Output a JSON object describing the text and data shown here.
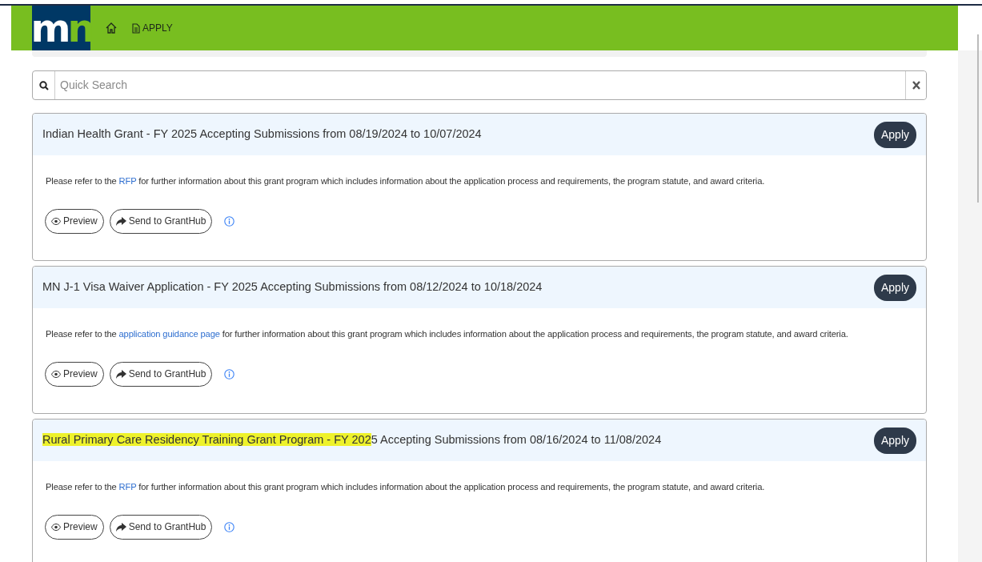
{
  "navbar": {
    "logo": "mn",
    "links": [
      {
        "kind": "home"
      },
      {
        "kind": "document",
        "label": "APPLY"
      }
    ]
  },
  "search": {
    "placeholder": "Quick Search"
  },
  "grants": [
    {
      "title": [
        {
          "text": "Indian Health Grant - FY 2025 Accepting Submissions from 08/19/2024 to 10/07/2024",
          "highlighted": false
        }
      ],
      "apply": "Apply",
      "description": {
        "before": "Please refer to the ",
        "link": "RFP",
        "after": " for further information about this grant program which includes information about the application process and requirements, the program statute, and award criteria."
      },
      "buttons": [
        {
          "kind": "preview",
          "label": "Preview"
        },
        {
          "kind": "send",
          "label": "Send to GrantHub"
        }
      ]
    },
    {
      "title": [
        {
          "text": "MN J-1 Visa Waiver Application - FY 2025 Accepting Submissions from 08/12/2024 to 10/18/2024",
          "highlighted": false
        }
      ],
      "apply": "Apply",
      "description": {
        "before": "Please refer to the ",
        "link": "application guidance page",
        "after": " for further information about this grant program which includes information about the application process and requirements, the program statute, and award criteria."
      },
      "buttons": [
        {
          "kind": "preview",
          "label": "Preview"
        },
        {
          "kind": "send",
          "label": "Send to GrantHub"
        }
      ]
    },
    {
      "title": [
        {
          "text": "Rural Primary Care Residency Training Grant Program - FY 202",
          "highlighted": true
        },
        {
          "text": "5 Accepting Submissions from 08/16/2024 to 11/08/2024",
          "highlighted": false
        }
      ],
      "apply": "Apply",
      "description": {
        "before": "Please refer to the ",
        "link": "RFP",
        "after": " for further information about this grant program which includes information about the application process and requirements, the program statute, and award criteria."
      },
      "buttons": [
        {
          "kind": "preview",
          "label": "Preview"
        },
        {
          "kind": "send",
          "label": "Send to GrantHub"
        }
      ]
    }
  ]
}
